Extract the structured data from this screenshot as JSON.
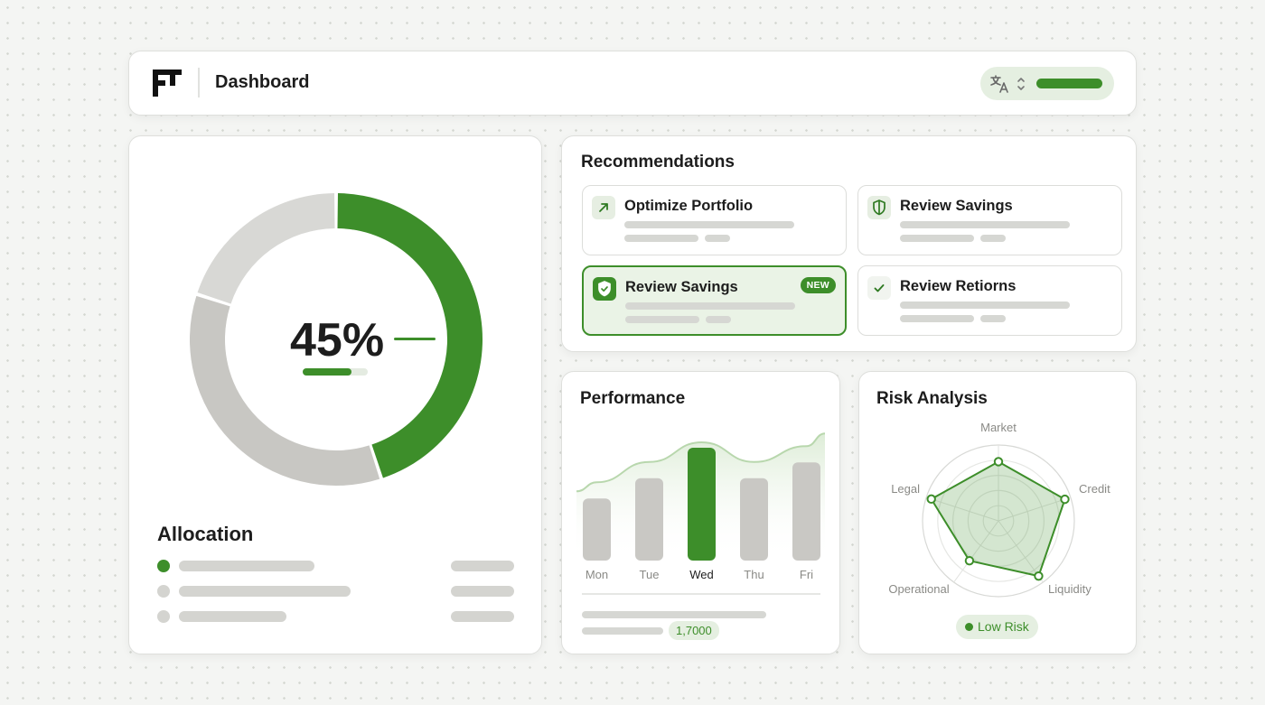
{
  "header": {
    "title": "Dashboard",
    "logo_icon": "ft-logo-icon",
    "language_icon": "translate-icon",
    "selector_icon": "chevron-up-down-icon"
  },
  "allocation": {
    "percent_label": "45%",
    "percent_value": 45,
    "progress_fraction": 0.75,
    "title": "Allocation",
    "segments": [
      {
        "share": 0.45,
        "color": "#3d8e2a"
      },
      {
        "share": 0.35,
        "color": "#c8c7c3"
      },
      {
        "share": 0.2,
        "color": "#d8d8d5"
      }
    ],
    "legend_colors": [
      "#3d8e2a",
      "#d4d4d0",
      "#d4d4d0"
    ]
  },
  "recommendations": {
    "title": "Recommendations",
    "items": [
      {
        "title": "Optimize Portfolio",
        "icon": "arrow-up-right-icon"
      },
      {
        "title": "Review Savings",
        "icon": "shield-icon"
      },
      {
        "title": "Review Savings",
        "icon": "shield-check-icon",
        "badge": "NEW",
        "active": true
      },
      {
        "title": "Review Retiorns",
        "icon": "check-icon"
      }
    ]
  },
  "performance": {
    "title": "Performance",
    "footer_value": "1,7000"
  },
  "risk": {
    "title": "Risk Analysis",
    "status": "Low Risk",
    "axes": [
      "Market",
      "Credit",
      "Liquidity",
      "Operational",
      "Legal"
    ]
  },
  "chart_data": {
    "type": "bar",
    "categories": [
      "Mon",
      "Tue",
      "Wed",
      "Thu",
      "Fri"
    ],
    "values": [
      0.55,
      0.73,
      1.0,
      0.73,
      0.87
    ],
    "highlight": "Wed",
    "trend_line": true,
    "colors": {
      "bar": "#c9c8c4",
      "highlight": "#3d8e2a",
      "trend": "#b8d7ad"
    }
  },
  "radar_data": {
    "type": "radar",
    "axes": [
      "Market",
      "Credit",
      "Liquidity",
      "Operational",
      "Legal"
    ],
    "values": [
      0.78,
      0.92,
      0.9,
      0.65,
      0.93
    ],
    "color": "#3d8e2a"
  },
  "colors": {
    "accent": "#3d8e2a",
    "accent_light": "#e5efe1",
    "neutral": "#d4d4d0"
  }
}
